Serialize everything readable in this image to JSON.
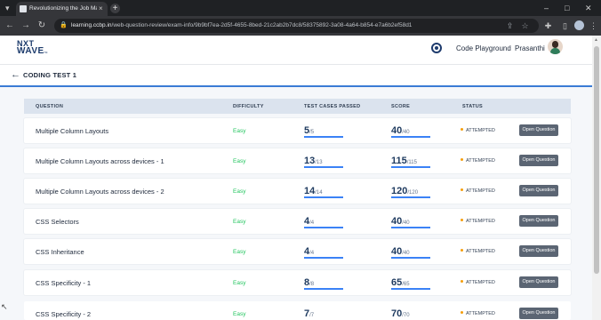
{
  "browser": {
    "tab_title": "Revolutionizing the Job Market",
    "tab_close": "×",
    "new_tab": "+",
    "dropdown": "▾",
    "url_host": "learning.ccbp.in",
    "url_path": "/web-question-review/exam-info/9b9bf7ea-2d5f-4655-8bed-21c2ab2b7dc8/58375892-3a08-4a64-b854-e7a6b2ef58d1",
    "back": "←",
    "forward": "→",
    "reload": "↻",
    "minimize": "–",
    "maximize": "□",
    "close": "✕",
    "icons": [
      "share-icon",
      "star-icon",
      "extensions-icon",
      "sidepanel-icon",
      "profile-icon",
      "menu-icon"
    ]
  },
  "header": {
    "logo_line1": "NXT",
    "logo_line2": "WAVE",
    "logo_tm": "TM",
    "playground_label": "Code Playground",
    "user_name": "Prasanthi"
  },
  "page": {
    "back_arrow": "←",
    "title": "CODING TEST 1"
  },
  "table": {
    "columns": [
      "QUESTION",
      "DIFFICULTY",
      "TEST CASES PASSED",
      "SCORE",
      "STATUS"
    ],
    "rows": [
      {
        "question": "Multiple Column Layouts",
        "difficulty": "Easy",
        "passed": "5",
        "total_cases": "/5",
        "score": "40",
        "max_score": "/40",
        "status": "ATTEMPTED",
        "action": "Open Question"
      },
      {
        "question": "Multiple Column Layouts across devices - 1",
        "difficulty": "Easy",
        "passed": "13",
        "total_cases": "/13",
        "score": "115",
        "max_score": "/115",
        "status": "ATTEMPTED",
        "action": "Open Question"
      },
      {
        "question": "Multiple Column Layouts across devices - 2",
        "difficulty": "Easy",
        "passed": "14",
        "total_cases": "/14",
        "score": "120",
        "max_score": "/120",
        "status": "ATTEMPTED",
        "action": "Open Question"
      },
      {
        "question": "CSS Selectors",
        "difficulty": "Easy",
        "passed": "4",
        "total_cases": "/4",
        "score": "40",
        "max_score": "/40",
        "status": "ATTEMPTED",
        "action": "Open Question"
      },
      {
        "question": "CSS Inheritance",
        "difficulty": "Easy",
        "passed": "4",
        "total_cases": "/4",
        "score": "40",
        "max_score": "/40",
        "status": "ATTEMPTED",
        "action": "Open Question"
      },
      {
        "question": "CSS Specificity - 1",
        "difficulty": "Easy",
        "passed": "8",
        "total_cases": "/8",
        "score": "65",
        "max_score": "/65",
        "status": "ATTEMPTED",
        "action": "Open Question"
      },
      {
        "question": "CSS Specificity - 2",
        "difficulty": "Easy",
        "passed": "7",
        "total_cases": "/7",
        "score": "70",
        "max_score": "/70",
        "status": "ATTEMPTED",
        "action": "Open Question"
      }
    ]
  },
  "colors": {
    "accent": "#3a7bd5",
    "easy": "#22c55e",
    "status_dot": "#f59e0b",
    "button": "#5b6573"
  }
}
